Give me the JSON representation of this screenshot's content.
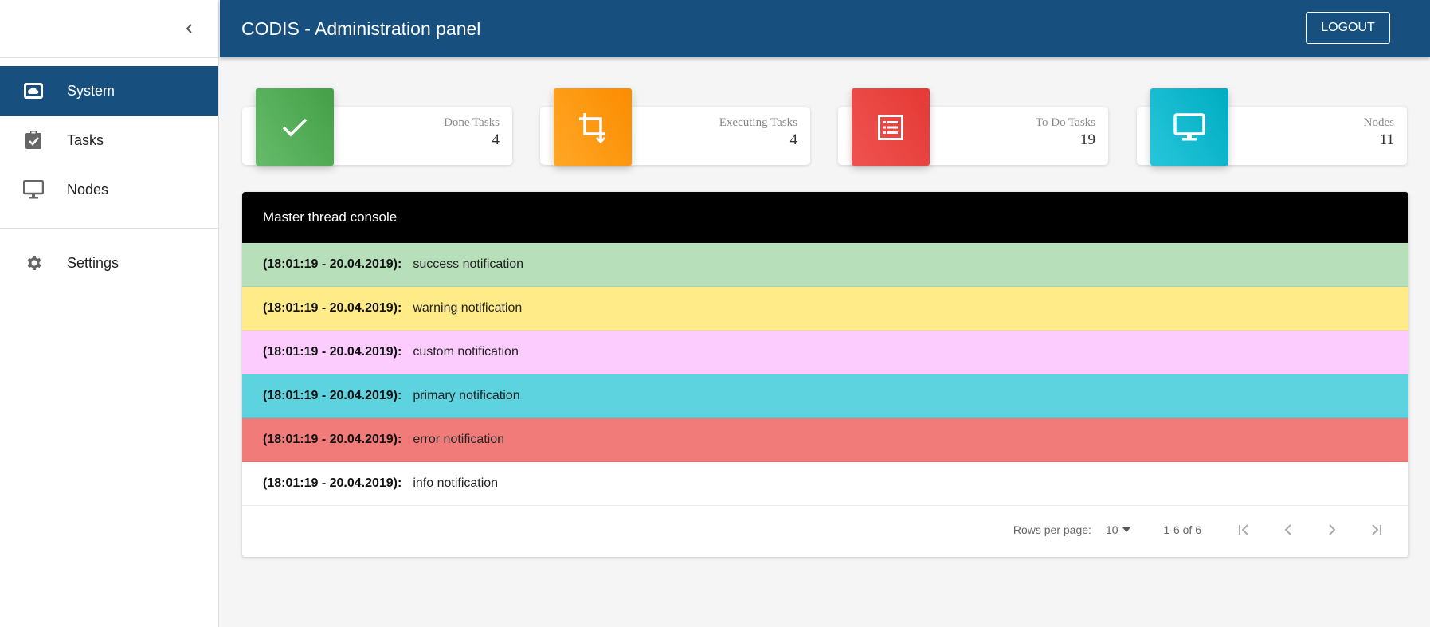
{
  "app": {
    "title": "CODIS - Administration panel",
    "logout_label": "LOGOUT"
  },
  "sidebar": {
    "collapse_icon": "chevron-left-icon",
    "items": [
      {
        "label": "System",
        "icon": "cloud-box-icon",
        "active": true
      },
      {
        "label": "Tasks",
        "icon": "clipboard-check-icon",
        "active": false
      },
      {
        "label": "Nodes",
        "icon": "monitor-icon",
        "active": false
      },
      {
        "label": "Settings",
        "icon": "gear-icon",
        "active": false
      }
    ]
  },
  "stats": [
    {
      "label": "Done Tasks",
      "value": "4",
      "icon": "check-icon",
      "color": "#4caf50"
    },
    {
      "label": "Executing Tasks",
      "value": "4",
      "icon": "crop-icon",
      "color": "#fb8c00"
    },
    {
      "label": "To Do Tasks",
      "value": "19",
      "icon": "list-icon",
      "color": "#e53935"
    },
    {
      "label": "Nodes",
      "value": "11",
      "icon": "monitor-icon",
      "color": "#00acc1"
    }
  ],
  "console": {
    "title": "Master thread console",
    "rows": [
      {
        "time": "(18:01:19 - 20.04.2019):",
        "message": "success notification",
        "color": "#b7dfba"
      },
      {
        "time": "(18:01:19 - 20.04.2019):",
        "message": "warning notification",
        "color": "#ffeb88"
      },
      {
        "time": "(18:01:19 - 20.04.2019):",
        "message": "custom notification",
        "color": "#fcccff"
      },
      {
        "time": "(18:01:19 - 20.04.2019):",
        "message": "primary notification",
        "color": "#5ed3e0"
      },
      {
        "time": "(18:01:19 - 20.04.2019):",
        "message": "error notification",
        "color": "#f07b79"
      },
      {
        "time": "(18:01:19 - 20.04.2019):",
        "message": "info notification",
        "color": "#ffffff"
      }
    ],
    "pagination": {
      "rows_per_page_label": "Rows per page:",
      "rows_per_page": "10",
      "range": "1-6 of 6"
    }
  }
}
